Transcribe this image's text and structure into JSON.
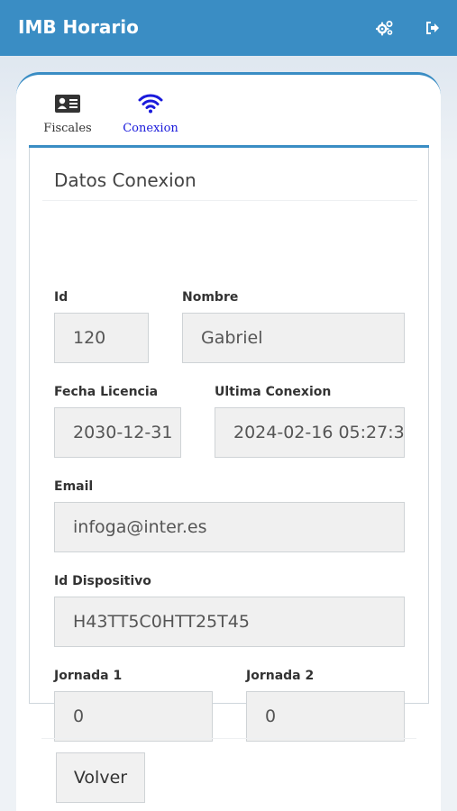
{
  "app": {
    "title": "IMB Horario"
  },
  "tabs": [
    {
      "label": "Fiscales",
      "icon": "id-card-icon"
    },
    {
      "label": "Conexion",
      "icon": "wifi-icon"
    }
  ],
  "panel": {
    "title": "Datos Conexion",
    "fields": {
      "id": {
        "label": "Id",
        "value": "120"
      },
      "nombre": {
        "label": "Nombre",
        "value": "Gabriel"
      },
      "fecha_licencia": {
        "label": "Fecha Licencia",
        "value": "2030-12-31"
      },
      "ultima_conexion": {
        "label": "Ultima Conexion",
        "value": "2024-02-16 05:27:3"
      },
      "email": {
        "label": "Email",
        "value": "infoga@inter.es"
      },
      "id_dispositivo": {
        "label": "Id Dispositivo",
        "value": "H43TT5C0HTT25T45"
      },
      "jornada1": {
        "label": "Jornada 1",
        "value": "0"
      },
      "jornada2": {
        "label": "Jornada 2",
        "value": "0"
      }
    }
  },
  "footer": {
    "volver_label": "Volver"
  },
  "colors": {
    "header": "#3a8dc4",
    "active_tab": "#1a1adb"
  }
}
